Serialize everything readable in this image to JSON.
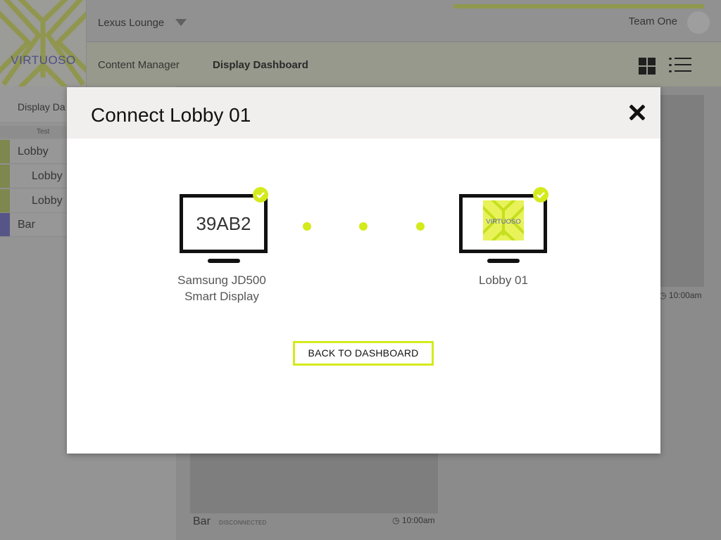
{
  "app": {
    "logo_text": "VIRTUOSO",
    "venue": "Lexus Lounge",
    "team": "Team One",
    "nav": {
      "content_manager": "Content Manager",
      "display_dashboard": "Display Dashboard"
    }
  },
  "sidebar": {
    "header": "Display Da",
    "group_label": "Test",
    "items": [
      {
        "label": "Lobby",
        "color": "#c8d67a"
      },
      {
        "label": "Lobby",
        "color": "#c8d67a"
      },
      {
        "label": "Lobby",
        "color": "#c8d67a"
      },
      {
        "label": "Bar",
        "color": "#8a86d6"
      }
    ]
  },
  "cards": {
    "right_time": "10:00am",
    "bottom_title": "Bar",
    "bottom_status": "DISCONNECTED",
    "bottom_time": "10:00am"
  },
  "modal": {
    "title": "Connect Lobby 01",
    "source": {
      "code": "39AB2",
      "label_line1": "Samsung JD500",
      "label_line2": "Smart Display"
    },
    "target": {
      "logo_text": "VIRTUOSO",
      "label": "Lobby 01"
    },
    "back_button": "BACK TO DASHBOARD"
  },
  "colors": {
    "accent": "#d4ea1c",
    "brand_purple": "#7b7fd0"
  }
}
